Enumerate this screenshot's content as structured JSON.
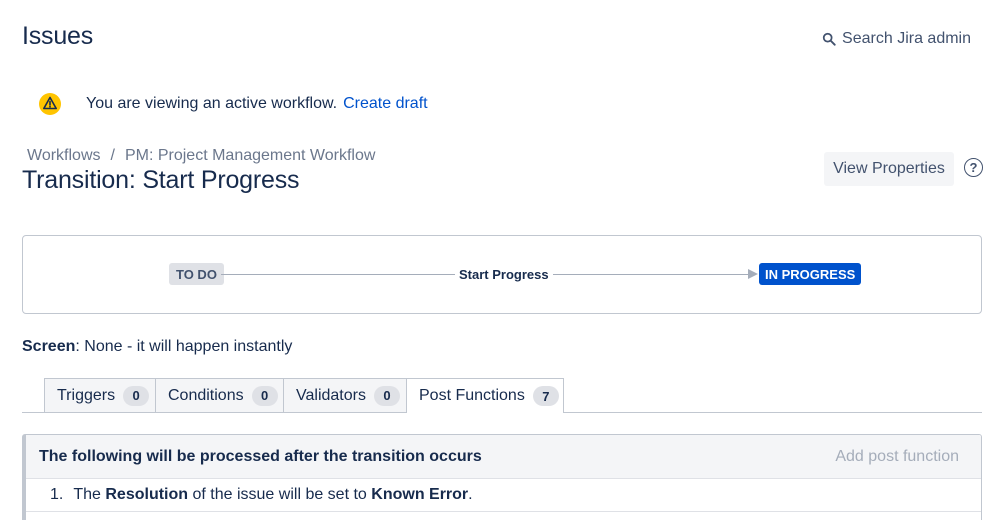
{
  "header": {
    "title": "Issues",
    "search_label": "Search Jira admin"
  },
  "warning": {
    "text": "You are viewing an active workflow.",
    "link": "Create draft"
  },
  "breadcrumb": {
    "items": [
      "Workflows",
      "PM: Project Management Workflow"
    ],
    "separator": "/"
  },
  "page": {
    "title": "Transition: Start Progress",
    "view_properties": "View Properties",
    "help": "?"
  },
  "diagram": {
    "from_status": "TO DO",
    "transition": "Start Progress",
    "to_status": "IN PROGRESS"
  },
  "screen": {
    "label": "Screen",
    "value": ": None - it will happen instantly"
  },
  "tabs": [
    {
      "label": "Triggers",
      "count": "0"
    },
    {
      "label": "Conditions",
      "count": "0"
    },
    {
      "label": "Validators",
      "count": "0"
    },
    {
      "label": "Post Functions",
      "count": "7",
      "active": true
    }
  ],
  "post_functions": {
    "heading": "The following will be processed after the transition occurs",
    "add_label": "Add post function",
    "items": [
      {
        "num": "1.",
        "pre": "The",
        "field": "Resolution",
        "mid": "of the issue will be set to",
        "value": "Known Error",
        "post": "."
      }
    ]
  },
  "colors": {
    "brand_blue": "#0052cc",
    "text": "#172b4d",
    "warning_yellow": "#ffc400"
  },
  "icons": {
    "search": "search-icon",
    "warning": "warning-icon",
    "help": "help-icon"
  }
}
